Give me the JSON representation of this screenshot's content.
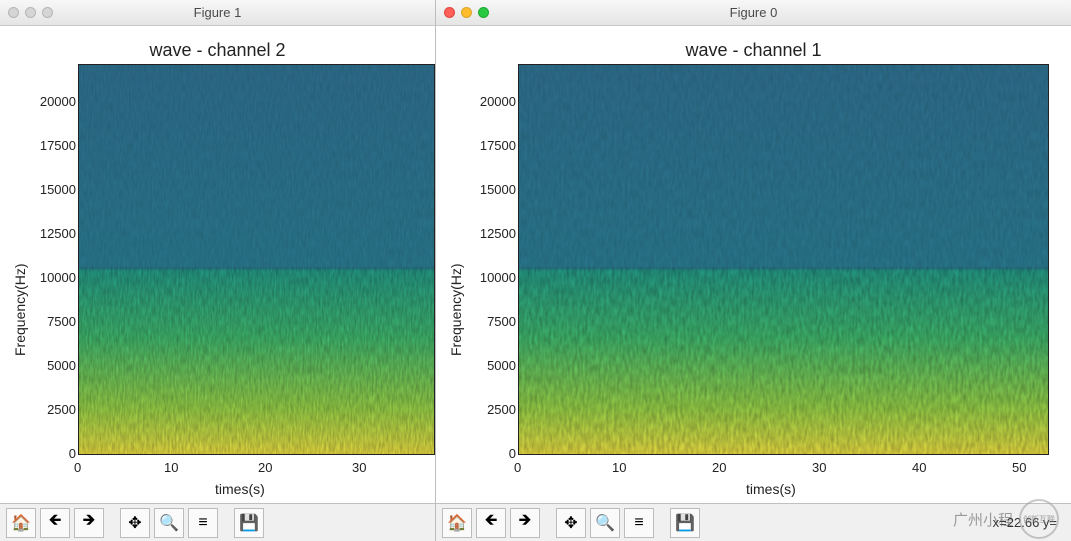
{
  "windows": {
    "left": {
      "title": "Figure 1",
      "traffic_active": false
    },
    "right": {
      "title": "Figure 0",
      "traffic_active": true,
      "coord_readout": "x=22.66    y="
    }
  },
  "charts": {
    "left": {
      "title": "wave - channel 2",
      "xlabel": "times(s)",
      "ylabel": "Frequency(Hz)",
      "y_ticks": [
        "0",
        "2500",
        "5000",
        "7500",
        "10000",
        "12500",
        "15000",
        "17500",
        "20000"
      ],
      "x_ticks": [
        "0",
        "10",
        "20",
        "30"
      ]
    },
    "right": {
      "title": "wave - channel 1",
      "xlabel": "times(s)",
      "ylabel": "Frequency(Hz)",
      "y_ticks": [
        "0",
        "2500",
        "5000",
        "7500",
        "10000",
        "12500",
        "15000",
        "17500",
        "20000"
      ],
      "x_ticks": [
        "0",
        "10",
        "20",
        "30",
        "40",
        "50"
      ]
    }
  },
  "toolbar": {
    "home": "⌂",
    "back": "←",
    "forward": "→",
    "pan": "✥",
    "zoom": "🔍",
    "configure": "≡",
    "save": "💾"
  },
  "watermark": {
    "text": "广州小程",
    "badge": "创新互联"
  },
  "chart_data": [
    {
      "figure": "Figure 1",
      "title": "wave - channel 2",
      "type": "heatmap",
      "representation": "spectrogram",
      "xlabel": "times(s)",
      "ylabel": "Frequency(Hz)",
      "xlim": [
        0,
        40
      ],
      "ylim": [
        0,
        22050
      ],
      "x_ticks": [
        0,
        10,
        20,
        30
      ],
      "y_ticks": [
        0,
        2500,
        5000,
        7500,
        10000,
        12500,
        15000,
        17500,
        20000
      ],
      "colormap": "viridis",
      "energy_band_breakpoint_hz": 10000,
      "notes": "High power-spectral-density (yellow/green) below ~10 kHz across full time range; low density (teal) above ~10 kHz. Right edge cut off by adjacent window."
    },
    {
      "figure": "Figure 0",
      "title": "wave - channel 1",
      "type": "heatmap",
      "representation": "spectrogram",
      "xlabel": "times(s)",
      "ylabel": "Frequency(Hz)",
      "xlim": [
        0,
        54
      ],
      "ylim": [
        0,
        22050
      ],
      "x_ticks": [
        0,
        10,
        20,
        30,
        40,
        50
      ],
      "y_ticks": [
        0,
        2500,
        5000,
        7500,
        10000,
        12500,
        15000,
        17500,
        20000
      ],
      "colormap": "viridis",
      "energy_band_breakpoint_hz": 10000,
      "notes": "High power-spectral-density (yellow/green) below ~10 kHz across full 0–54 s range; low density (teal) above ~10 kHz.",
      "cursor_readout": {
        "x": 22.66,
        "y": null
      }
    }
  ]
}
